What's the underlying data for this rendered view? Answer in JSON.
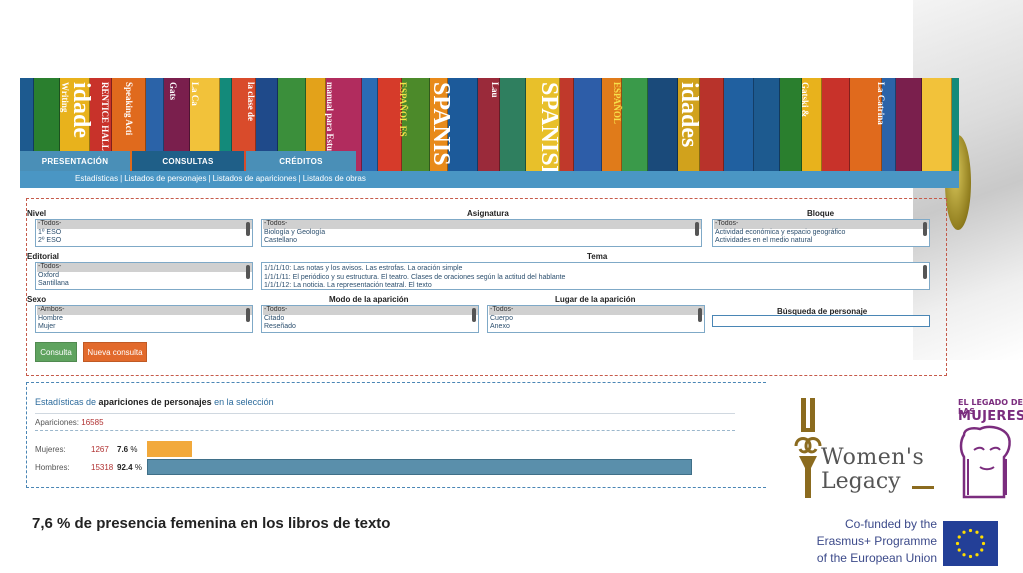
{
  "banner": {
    "tabs": [
      "PRESENTACIÓN",
      "CONSULTAS",
      "CRÉDITOS"
    ],
    "subnav": [
      "Estadísticas",
      "Listados de personajes",
      "Listados de apariciones",
      "Listados de obras"
    ]
  },
  "filters": {
    "nivel": {
      "label": "Nivel",
      "options": [
        "-Todos-",
        "1º ESO",
        "2º ESO"
      ]
    },
    "asignatura": {
      "label": "Asignatura",
      "options": [
        "-Todos-",
        "Biología y Geología",
        "Castellano"
      ]
    },
    "bloque": {
      "label": "Bloque",
      "options": [
        "-Todos-",
        "Actividad económica y espacio geográfico",
        "Actividades en el medio natural"
      ]
    },
    "editorial": {
      "label": "Editorial",
      "options": [
        "-Todos-",
        "Oxford",
        "Santillana"
      ]
    },
    "tema": {
      "label": "Tema",
      "options": [
        "1/1/1/10: Las notas y los avisos. Las estrofas. La oración simple",
        "1/1/1/11: El periódico y su estructura. El teatro. Clases de oraciones según la actitud del hablante",
        "1/1/1/12: La noticia. La representación teatral. El texto"
      ]
    },
    "sexo": {
      "label": "Sexo",
      "options": [
        "-Ambos-",
        "Hombre",
        "Mujer"
      ]
    },
    "modo": {
      "label": "Modo de la aparición",
      "options": [
        "-Todos-",
        "Citado",
        "Reseñado"
      ]
    },
    "lugar": {
      "label": "Lugar de la aparición",
      "options": [
        "-Todos-",
        "Cuerpo",
        "Anexo"
      ]
    },
    "busqueda": {
      "label": "Búsqueda de personaje",
      "value": ""
    },
    "buttons": {
      "consulta": "Consulta",
      "nueva": "Nueva consulta"
    }
  },
  "stats": {
    "title_pre": "Estadísticas de",
    "title_bold": "apariciones de personajes",
    "title_post": "en la selección",
    "apariciones_label": "Apariciones:",
    "apariciones_value": "16585",
    "rows": [
      {
        "label": "Mujeres:",
        "count": "1267",
        "pct": "7.6",
        "pct_suffix": "%",
        "fraction": 0.076
      },
      {
        "label": "Hombres:",
        "count": "15318",
        "pct": "92.4",
        "pct_suffix": "%",
        "fraction": 0.924
      }
    ]
  },
  "caption": "7,6 % de presencia femenina en los libros de texto",
  "logos": {
    "women_legacy_1": "Women's",
    "women_legacy_2": "Legacy",
    "legado_1": "EL LEGADO DE LAS",
    "legado_2": "MUJERES",
    "eu_line1": "Co-funded by the",
    "eu_line2": "Erasmus+ Programme",
    "eu_line3": "of the European Union"
  },
  "banner_spines": [
    "Writing",
    "idade",
    "RENTICE HALL",
    "Speaking Acti",
    "Gats",
    "La Ca",
    "la clase de",
    "manual para Estudiantes",
    "ESPAÑOL ES",
    "SPANIS",
    "Lau",
    "SPANISH",
    "ESPAÑOL",
    "idades",
    "Gatski &",
    "La Catrina"
  ]
}
